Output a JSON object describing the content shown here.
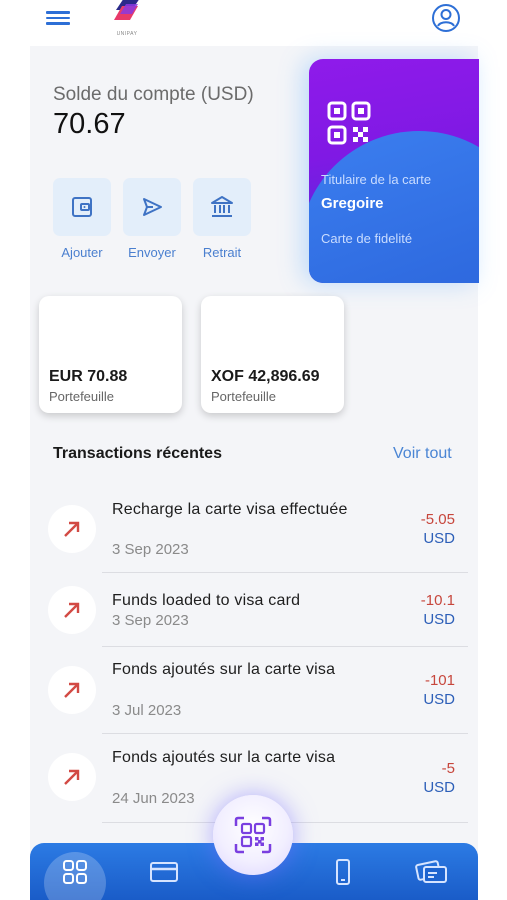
{
  "header": {
    "logo_text": "UNIPAY"
  },
  "balance": {
    "label": "Solde du compte (USD)",
    "value": "70.67"
  },
  "actions": [
    {
      "label": "Ajouter",
      "icon": "wallet-icon"
    },
    {
      "label": "Envoyer",
      "icon": "send-icon"
    },
    {
      "label": "Retrait",
      "icon": "bank-icon"
    }
  ],
  "card": {
    "holder_label": "Titulaire de la carte",
    "holder_name": "Gregoire",
    "type": "Carte de fidelité"
  },
  "wallets": [
    {
      "amount": "EUR 70.88",
      "label": "Portefeuille"
    },
    {
      "amount": "XOF 42,896.69",
      "label": "Portefeuille"
    }
  ],
  "transactions_section": {
    "title": "Transactions récentes",
    "see_all": "Voir tout"
  },
  "transactions": [
    {
      "title": "Recharge la carte visa effectuée",
      "date": "3 Sep 2023",
      "amount": "-5.05",
      "currency": "USD"
    },
    {
      "title": "Funds loaded to visa card",
      "date": "3 Sep 2023",
      "amount": "-10.1",
      "currency": "USD"
    },
    {
      "title": "Fonds ajoutés sur la carte visa",
      "date": "3 Jul 2023",
      "amount": "-101",
      "currency": "USD"
    },
    {
      "title": "Fonds ajoutés sur la carte visa",
      "date": "24 Jun 2023",
      "amount": "-5",
      "currency": "USD"
    }
  ],
  "colors": {
    "accent": "#2d6fd6",
    "negative_amount": "#c7463c",
    "currency": "#2d5fb8",
    "card_purple": "#8f1bea",
    "card_blue": "#3c7ff0"
  },
  "bottom_nav": [
    {
      "icon": "dashboard-icon",
      "active": true
    },
    {
      "icon": "card-icon",
      "active": false
    },
    {
      "icon": "qr-scan-icon",
      "active": false
    },
    {
      "icon": "phone-icon",
      "active": false
    },
    {
      "icon": "cards-stack-icon",
      "active": false
    }
  ]
}
